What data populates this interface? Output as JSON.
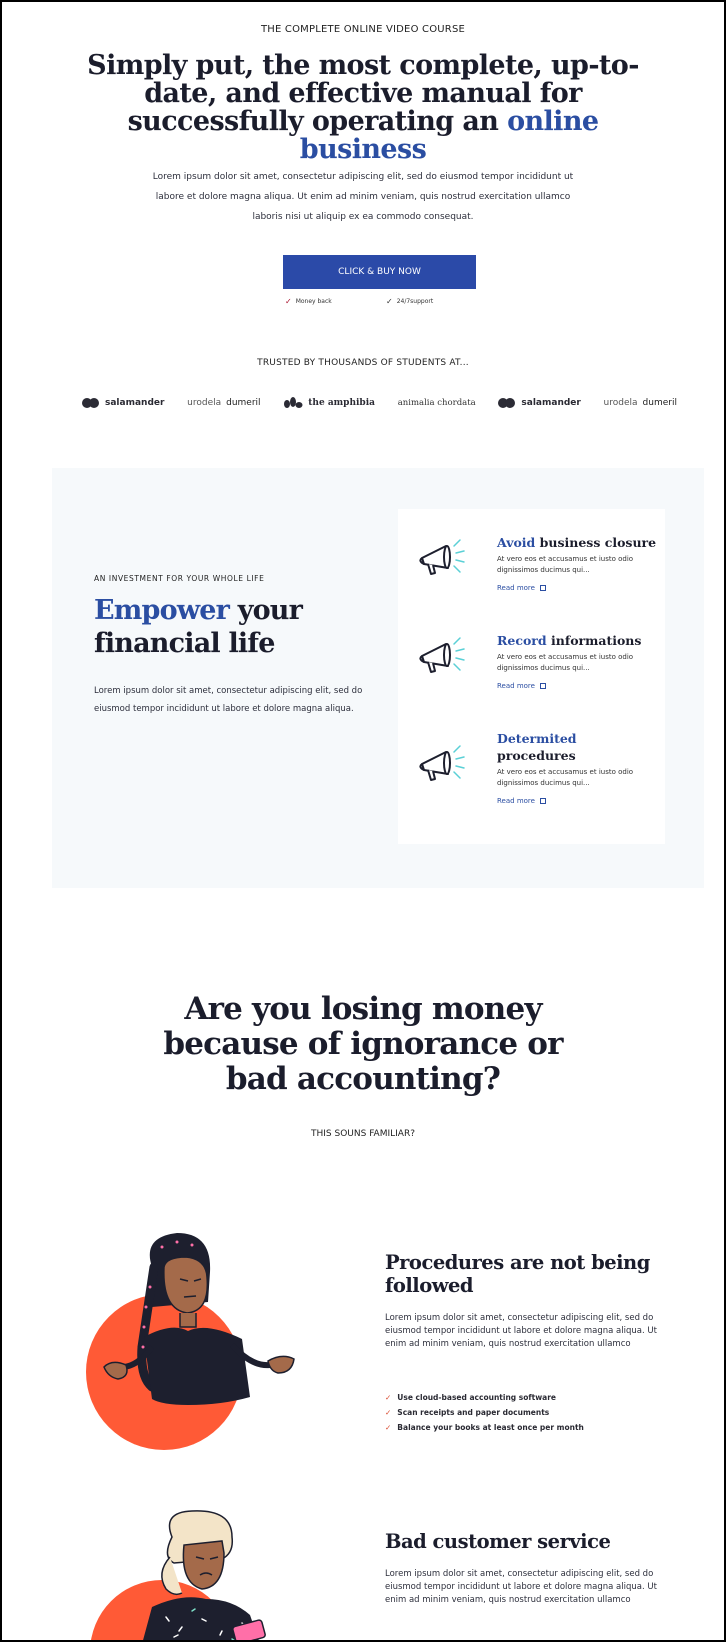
{
  "hero": {
    "eyebrow": "THE COMPLETE ONLINE VIDEO COURSE",
    "title_main": "Simply put, the most complete, up-to-date, and effective manual for successfully operating an ",
    "title_accent": "online business",
    "subtitle": "Lorem ipsum dolor sit amet, consectetur adipiscing elit, sed do eiusmod tempor incididunt ut labore et dolore magna aliqua. Ut enim ad minim veniam, quis nostrud exercitation ullamco laboris nisi ut aliquip ex ea commodo consequat.",
    "cta_label": "CLICK & BUY NOW",
    "perks": [
      "Money back",
      "24/7support"
    ]
  },
  "trusted": {
    "heading": "TRUSTED BY THOUSANDS OF STUDENTS AT...",
    "logos": [
      {
        "name": "salamander",
        "icon": "double-dot-icon"
      },
      {
        "name_a": "urodela",
        "name_b": "dumeril"
      },
      {
        "name": "the amphibia",
        "icon": "frog-icon"
      },
      {
        "name": "animalia chordata"
      },
      {
        "name": "salamander",
        "icon": "double-dot-icon"
      },
      {
        "name_a": "urodela",
        "name_b": "dumeril"
      }
    ]
  },
  "invest": {
    "eyebrow": "AN INVESTMENT FOR YOUR WHOLE LIFE",
    "title_accent": "Empower",
    "title_rest_1": " your",
    "title_rest_2": "financial life",
    "body": "Lorem ipsum dolor sit amet, consectetur adipiscing elit, sed do eiusmod tempor incididunt ut labore et dolore magna aliqua.",
    "features": [
      {
        "accent": "Avoid",
        "rest": " business closure",
        "desc": "At vero eos et accusamus et iusto odio dignissimos ducimus qui...",
        "link": "Read more"
      },
      {
        "accent": "Record",
        "rest": " informations",
        "desc": "At vero eos et accusamus et iusto odio dignissimos ducimus qui...",
        "link": "Read more"
      },
      {
        "accent": "Determited",
        "rest": "procedures",
        "desc": "At vero eos et accusamus et iusto odio dignissimos ducimus qui...",
        "link": "Read more"
      }
    ]
  },
  "losing": {
    "title_line1": "Are you losing money",
    "title_pre": "because of ",
    "title_bold1": "ignorance or",
    "title_bold2": "bad accounting",
    "title_q": "?",
    "subtitle": "THIS SOUNS FAMILIAR?"
  },
  "problems": [
    {
      "title": "Procedures are not being followed",
      "body": "Lorem ipsum dolor sit amet, consectetur adipiscing elit, sed do eiusmod tempor incididunt ut labore et dolore magna aliqua. Ut enim ad minim veniam, quis nostrud exercitation ullamco",
      "bullets": [
        "Use cloud-based accounting software",
        "Scan receipts and paper documents",
        "Balance your books at least once per month"
      ]
    },
    {
      "title": "Bad customer service",
      "body": "Lorem ipsum dolor sit amet, consectetur adipiscing elit, sed do eiusmod tempor incididunt ut labore et dolore magna aliqua. Ut enim ad minim veniam, quis nostrud exercitation ullamco"
    }
  ],
  "colors": {
    "accent": "#2b4ea2",
    "cta": "#2b4aa8",
    "coral": "#ff5a36",
    "panel": "#f6f9fb"
  }
}
